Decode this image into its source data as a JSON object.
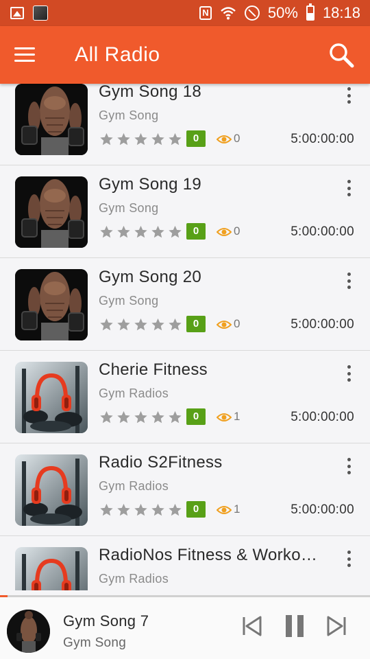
{
  "status_bar": {
    "battery": "50%",
    "time": "18:18",
    "nfc_label": "N"
  },
  "app_bar": {
    "title": "All Radio",
    "menu_icon": "hamburger-menu-icon",
    "search_icon": "search-icon"
  },
  "colors": {
    "status_bar": "#d24a24",
    "app_bar": "#f05a2c",
    "rating_badge": "#58a017",
    "views_icon": "#f0a020"
  },
  "stations": [
    {
      "title": "Gym Song 18",
      "category": "Gym Song",
      "rating": "0",
      "views": "0",
      "duration": "5:00:00:00",
      "art": "gym"
    },
    {
      "title": "Gym Song 19",
      "category": "Gym Song",
      "rating": "0",
      "views": "0",
      "duration": "5:00:00:00",
      "art": "gym"
    },
    {
      "title": "Gym Song 20",
      "category": "Gym Song",
      "rating": "0",
      "views": "0",
      "duration": "5:00:00:00",
      "art": "gym"
    },
    {
      "title": "Cherie Fitness",
      "category": "Gym Radios",
      "rating": "0",
      "views": "1",
      "duration": "5:00:00:00",
      "art": "fitness"
    },
    {
      "title": "Radio S2Fitness",
      "category": "Gym Radios",
      "rating": "0",
      "views": "1",
      "duration": "5:00:00:00",
      "art": "fitness"
    },
    {
      "title": "RadioNos Fitness & Workout...",
      "category": "Gym Radios",
      "rating": "",
      "views": "",
      "duration": "",
      "art": "fitness"
    }
  ],
  "now_playing": {
    "title": "Gym Song 7",
    "category": "Gym Song",
    "progress_fraction": 0.02
  }
}
